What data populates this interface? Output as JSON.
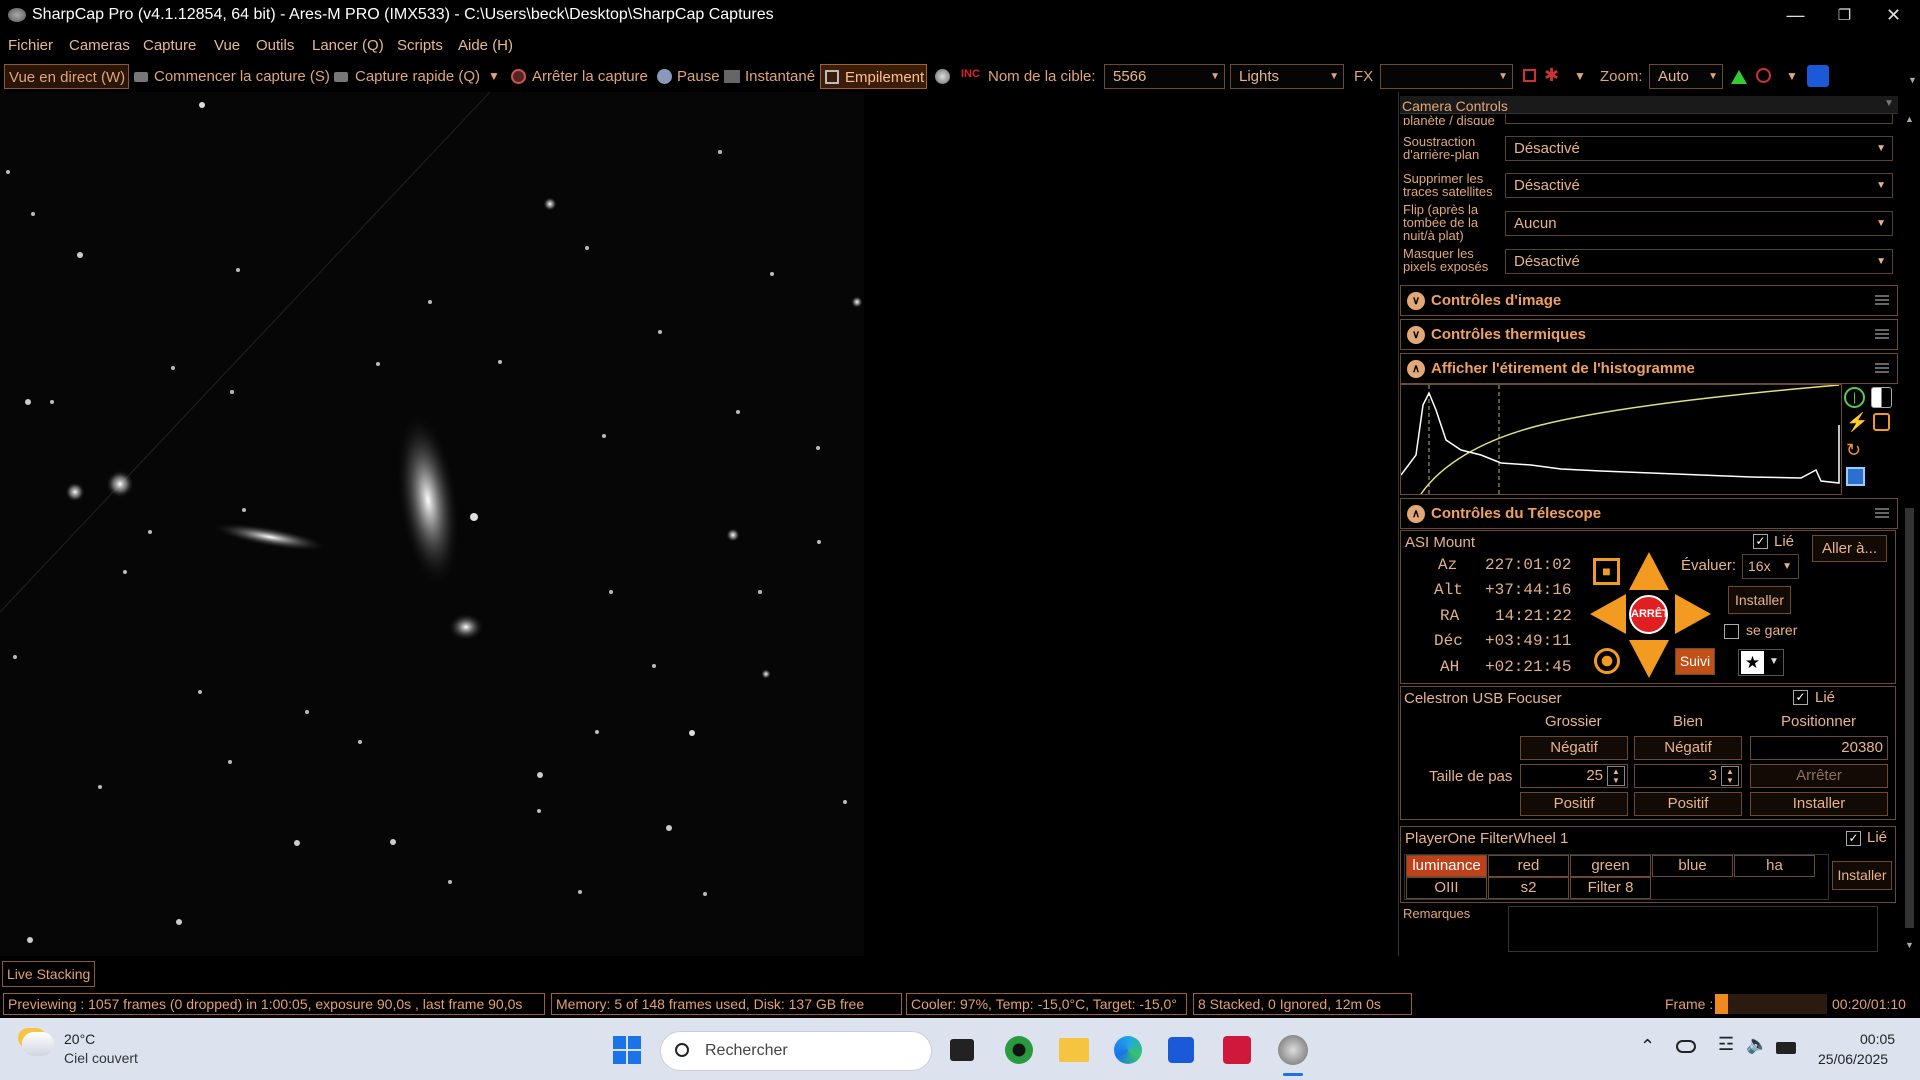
{
  "app": {
    "title": "SharpCap Pro (v4.1.12854, 64 bit) - Ares-M PRO (IMX533) - C:\\Users\\beck\\Desktop\\SharpCap Captures"
  },
  "menu": [
    "Fichier",
    "Cameras",
    "Capture",
    "Vue",
    "Outils",
    "Lancer (Q)",
    "Scripts",
    "Aide (H)"
  ],
  "toolbar": {
    "live_view": "Vue en direct (W)",
    "start_capture": "Commencer la capture (S)",
    "quick_capture": "Capture rapide (Q)",
    "stop_capture": "Arrêter la capture",
    "pause": "Pause",
    "snapshot": "Instantané",
    "stacking": "Empilement",
    "target_label": "Nom de la cible:",
    "target_value": "5566",
    "frame_type": "Lights",
    "fx_label": "FX",
    "fx_value": "",
    "zoom_label": "Zoom:",
    "zoom_value": "Auto"
  },
  "panel": {
    "title": "Camera Controls",
    "partial_label": "planète / disque",
    "rows": [
      {
        "label": "Soustraction d'arrière-plan",
        "value": "Désactivé"
      },
      {
        "label": "Supprimer les traces satellites",
        "value": "Désactivé"
      },
      {
        "label": "Flip (après la tombée de la nuit/à plat)",
        "value": "Aucun"
      },
      {
        "label": "Masquer les pixels exposés",
        "value": "Désactivé"
      }
    ],
    "sections": {
      "image": "Contrôles d'image",
      "thermal": "Contrôles thermiques",
      "histogram": "Afficher l'étirement de l'histogramme",
      "telescope": "Contrôles du Télescope"
    },
    "mount": {
      "name": "ASI Mount",
      "linked": "Lié",
      "goto": "Aller à...",
      "coords": [
        {
          "label": "Az",
          "value": "227:01:02"
        },
        {
          "label": "Alt",
          "value": "+37:44:16"
        },
        {
          "label": "RA",
          "value": "14:21:22"
        },
        {
          "label": "Déc",
          "value": "+03:49:11"
        },
        {
          "label": "AH",
          "value": "+02:21:45"
        }
      ],
      "rate_label": "Évaluer:",
      "rate_value": "16x",
      "stop": "ARRÊTE",
      "setup": "Installer",
      "park": "se garer",
      "tracking": "Suivi"
    },
    "focuser": {
      "name": "Celestron USB Focuser",
      "linked": "Lié",
      "col_coarse": "Grossier",
      "col_fine": "Bien",
      "col_position": "Positionner",
      "negative": "Négatif",
      "positive": "Positif",
      "position_value": "20380",
      "step_label": "Taille de pas",
      "coarse_step": "25",
      "fine_step": "3",
      "stop": "Arrêter",
      "install": "Installer"
    },
    "filterwheel": {
      "name": "PlayerOne FilterWheel 1",
      "linked": "Lié",
      "filters": [
        "luminance",
        "red",
        "green",
        "blue",
        "ha",
        "OIII",
        "s2",
        "Filter 8"
      ],
      "install": "Installer"
    },
    "notes_label": "Remarques"
  },
  "live_stacking_tab": "Live Stacking",
  "status": {
    "preview": "Previewing : 1057 frames (0 dropped) in 1:00:05, exposure 90,0s , last frame 90,0s",
    "memory": "Memory: 5 of 148 frames used, Disk: 137 GB free",
    "cooler": "Cooler: 97%, Temp: -15,0°C, Target: -15,0°",
    "stacked": "8 Stacked, 0 Ignored, 12m 0s",
    "frame_label": "Frame :",
    "frame_progress": 0.12,
    "time": "00:20/01:10"
  },
  "taskbar": {
    "weather_temp": "20°C",
    "weather_desc": "Ciel couvert",
    "search_placeholder": "Rechercher",
    "clock_time": "00:05",
    "clock_date": "25/06/2025"
  },
  "colors": {
    "accent": "#f39a20",
    "text": "#e2a878",
    "stop_red": "#e02020",
    "selected_filter": "#c0401a"
  }
}
